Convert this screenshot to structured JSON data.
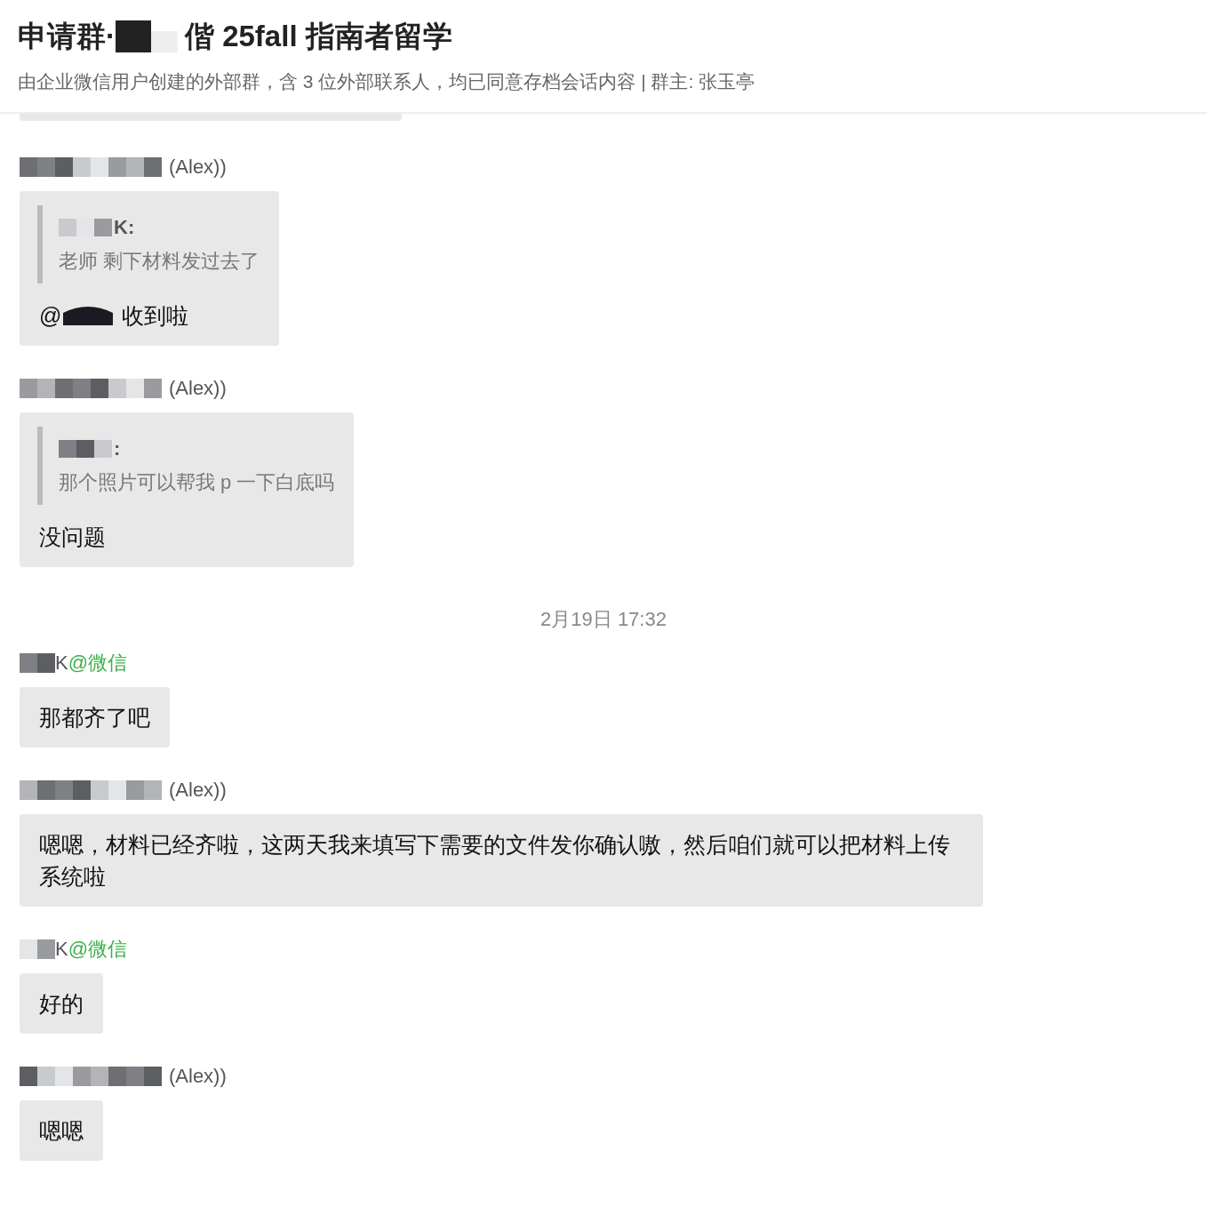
{
  "header": {
    "title_prefix": "申请群·",
    "title_suffix": "偕 25fall 指南者留学",
    "subtitle": "由企业微信用户创建的外部群，含 3 位外部联系人，均已同意存档会话内容 | 群主: 张玉亭"
  },
  "messages": [
    {
      "kind": "quote_reply",
      "sender": {
        "name": "(Alex))"
      },
      "quote": {
        "author": "K:",
        "text": "老师 剩下材料发过去了"
      },
      "mention": "@",
      "text": "收到啦"
    },
    {
      "kind": "quote_reply",
      "sender": {
        "name": "(Alex))"
      },
      "quote": {
        "author": ":",
        "text": "那个照片可以帮我 p 一下白底吗"
      },
      "text": "没问题"
    },
    {
      "kind": "time",
      "text": "2月19日 17:32"
    },
    {
      "kind": "text",
      "sender": {
        "name": "K",
        "source": "@微信"
      },
      "text": "那都齐了吧"
    },
    {
      "kind": "text",
      "sender": {
        "name": "(Alex))"
      },
      "text": "嗯嗯，材料已经齐啦，这两天我来填写下需要的文件发你确认嗷，然后咱们就可以把材料上传系统啦"
    },
    {
      "kind": "text",
      "sender": {
        "name": "K",
        "source": "@微信"
      },
      "text": "好的"
    },
    {
      "kind": "text",
      "sender": {
        "name": "(Alex))"
      },
      "text": "嗯嗯"
    }
  ]
}
